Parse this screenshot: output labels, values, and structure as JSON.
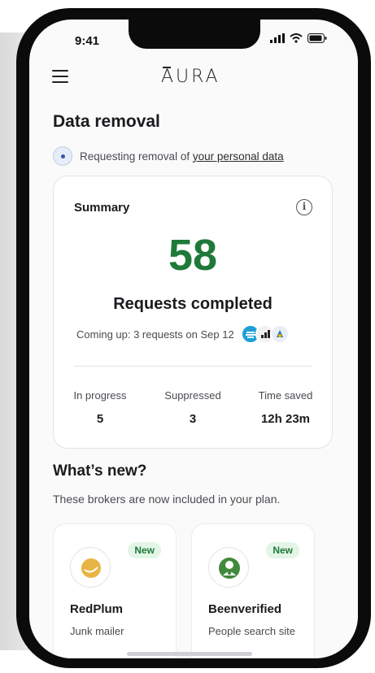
{
  "status_bar": {
    "time": "9:41"
  },
  "header": {
    "logo_text": "AURA"
  },
  "page": {
    "title": "Data removal",
    "status_text": "Requesting removal of ",
    "status_link": "your personal data"
  },
  "summary": {
    "label": "Summary",
    "count": "58",
    "count_label": "Requests completed",
    "coming_up": "Coming up: 3 requests on Sep 12",
    "stats": [
      {
        "label": "In progress",
        "value": "5"
      },
      {
        "label": "Suppressed",
        "value": "3"
      },
      {
        "label": "Time saved",
        "value": "12h 23m"
      }
    ]
  },
  "whats_new": {
    "title": "What’s new?",
    "subtitle": "These brokers are now included in your plan.",
    "brokers": [
      {
        "name": "RedPlum",
        "type": "Junk mailer",
        "badge": "New",
        "logo_color": "#e8b545"
      },
      {
        "name": "Beenverified",
        "type": "People search site",
        "badge": "New",
        "logo_color": "#3f8a3c"
      }
    ]
  },
  "colors": {
    "accent_green": "#1f7a3a",
    "badge_bg": "#e3f5e6"
  }
}
